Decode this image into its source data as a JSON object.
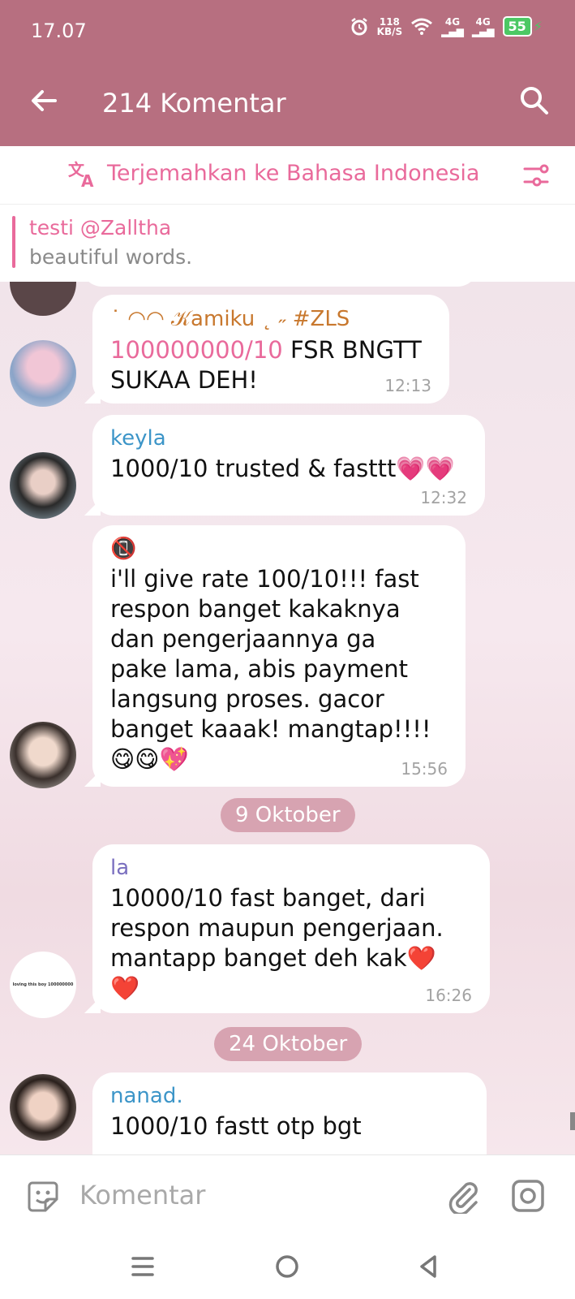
{
  "status_bar": {
    "time": "17.07",
    "net_speed_value": "118",
    "net_speed_unit": "KB/S",
    "signal_1": "4G",
    "signal_2": "4G",
    "battery": "55"
  },
  "app_bar": {
    "title": "214 Komentar"
  },
  "translate_bar": {
    "label": "Terjemahkan ke Bahasa Indonesia"
  },
  "pinned": {
    "title": "testi @Zalltha",
    "text": "beautiful words."
  },
  "messages": [
    {
      "name": "˙ ◠◠ 𝒦amiku ˛ ˶ #ZLS",
      "name_color": "#c8782e",
      "highlight": "100000000/10",
      "text": " FSR BNGTT\nSUKAA DEH!",
      "time": "12:13"
    },
    {
      "name": "keyla",
      "name_color": "#3c95c8",
      "text": "1000/10 trusted & fasttt💗💗",
      "time": "12:32"
    },
    {
      "name": "📵",
      "name_color": "#e05a4f",
      "text": "i'll give rate 100/10!!! fast\nrespon banget kakaknya\ndan pengerjaannya ga\npake lama, abis payment\nlangsung proses. gacor\nbanget kaaak! mangtap!!!!\n😋😋💖",
      "time": "15:56"
    },
    {
      "name": "la",
      "name_color": "#7a6fbf",
      "text": "10000/10 fast banget, dari\nrespon maupun pengerjaan.\nmantapp banget deh kak❤️\n❤️",
      "time": "16:26",
      "avatar_text": "loving this boy 100000000"
    },
    {
      "name": "nanad.",
      "name_color": "#3c95c8",
      "text": "1000/10 fastt otp bgt"
    }
  ],
  "dates": [
    "9 Oktober",
    "24 Oktober"
  ],
  "composer": {
    "placeholder": "Komentar"
  },
  "colors": {
    "accent": "#b76f80",
    "link": "#e96a9b"
  }
}
